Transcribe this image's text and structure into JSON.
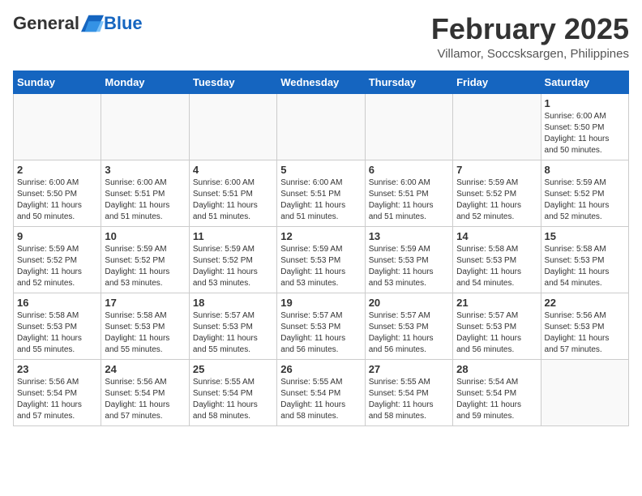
{
  "header": {
    "logo": {
      "general": "General",
      "blue": "Blue"
    },
    "title": "February 2025",
    "location": "Villamor, Soccsksargen, Philippines"
  },
  "days_of_week": [
    "Sunday",
    "Monday",
    "Tuesday",
    "Wednesday",
    "Thursday",
    "Friday",
    "Saturday"
  ],
  "weeks": [
    [
      {
        "day": "",
        "info": ""
      },
      {
        "day": "",
        "info": ""
      },
      {
        "day": "",
        "info": ""
      },
      {
        "day": "",
        "info": ""
      },
      {
        "day": "",
        "info": ""
      },
      {
        "day": "",
        "info": ""
      },
      {
        "day": "1",
        "info": "Sunrise: 6:00 AM\nSunset: 5:50 PM\nDaylight: 11 hours\nand 50 minutes."
      }
    ],
    [
      {
        "day": "2",
        "info": "Sunrise: 6:00 AM\nSunset: 5:50 PM\nDaylight: 11 hours\nand 50 minutes."
      },
      {
        "day": "3",
        "info": "Sunrise: 6:00 AM\nSunset: 5:51 PM\nDaylight: 11 hours\nand 51 minutes."
      },
      {
        "day": "4",
        "info": "Sunrise: 6:00 AM\nSunset: 5:51 PM\nDaylight: 11 hours\nand 51 minutes."
      },
      {
        "day": "5",
        "info": "Sunrise: 6:00 AM\nSunset: 5:51 PM\nDaylight: 11 hours\nand 51 minutes."
      },
      {
        "day": "6",
        "info": "Sunrise: 6:00 AM\nSunset: 5:51 PM\nDaylight: 11 hours\nand 51 minutes."
      },
      {
        "day": "7",
        "info": "Sunrise: 5:59 AM\nSunset: 5:52 PM\nDaylight: 11 hours\nand 52 minutes."
      },
      {
        "day": "8",
        "info": "Sunrise: 5:59 AM\nSunset: 5:52 PM\nDaylight: 11 hours\nand 52 minutes."
      }
    ],
    [
      {
        "day": "9",
        "info": "Sunrise: 5:59 AM\nSunset: 5:52 PM\nDaylight: 11 hours\nand 52 minutes."
      },
      {
        "day": "10",
        "info": "Sunrise: 5:59 AM\nSunset: 5:52 PM\nDaylight: 11 hours\nand 53 minutes."
      },
      {
        "day": "11",
        "info": "Sunrise: 5:59 AM\nSunset: 5:52 PM\nDaylight: 11 hours\nand 53 minutes."
      },
      {
        "day": "12",
        "info": "Sunrise: 5:59 AM\nSunset: 5:53 PM\nDaylight: 11 hours\nand 53 minutes."
      },
      {
        "day": "13",
        "info": "Sunrise: 5:59 AM\nSunset: 5:53 PM\nDaylight: 11 hours\nand 53 minutes."
      },
      {
        "day": "14",
        "info": "Sunrise: 5:58 AM\nSunset: 5:53 PM\nDaylight: 11 hours\nand 54 minutes."
      },
      {
        "day": "15",
        "info": "Sunrise: 5:58 AM\nSunset: 5:53 PM\nDaylight: 11 hours\nand 54 minutes."
      }
    ],
    [
      {
        "day": "16",
        "info": "Sunrise: 5:58 AM\nSunset: 5:53 PM\nDaylight: 11 hours\nand 55 minutes."
      },
      {
        "day": "17",
        "info": "Sunrise: 5:58 AM\nSunset: 5:53 PM\nDaylight: 11 hours\nand 55 minutes."
      },
      {
        "day": "18",
        "info": "Sunrise: 5:57 AM\nSunset: 5:53 PM\nDaylight: 11 hours\nand 55 minutes."
      },
      {
        "day": "19",
        "info": "Sunrise: 5:57 AM\nSunset: 5:53 PM\nDaylight: 11 hours\nand 56 minutes."
      },
      {
        "day": "20",
        "info": "Sunrise: 5:57 AM\nSunset: 5:53 PM\nDaylight: 11 hours\nand 56 minutes."
      },
      {
        "day": "21",
        "info": "Sunrise: 5:57 AM\nSunset: 5:53 PM\nDaylight: 11 hours\nand 56 minutes."
      },
      {
        "day": "22",
        "info": "Sunrise: 5:56 AM\nSunset: 5:53 PM\nDaylight: 11 hours\nand 57 minutes."
      }
    ],
    [
      {
        "day": "23",
        "info": "Sunrise: 5:56 AM\nSunset: 5:54 PM\nDaylight: 11 hours\nand 57 minutes."
      },
      {
        "day": "24",
        "info": "Sunrise: 5:56 AM\nSunset: 5:54 PM\nDaylight: 11 hours\nand 57 minutes."
      },
      {
        "day": "25",
        "info": "Sunrise: 5:55 AM\nSunset: 5:54 PM\nDaylight: 11 hours\nand 58 minutes."
      },
      {
        "day": "26",
        "info": "Sunrise: 5:55 AM\nSunset: 5:54 PM\nDaylight: 11 hours\nand 58 minutes."
      },
      {
        "day": "27",
        "info": "Sunrise: 5:55 AM\nSunset: 5:54 PM\nDaylight: 11 hours\nand 58 minutes."
      },
      {
        "day": "28",
        "info": "Sunrise: 5:54 AM\nSunset: 5:54 PM\nDaylight: 11 hours\nand 59 minutes."
      },
      {
        "day": "",
        "info": ""
      }
    ]
  ]
}
